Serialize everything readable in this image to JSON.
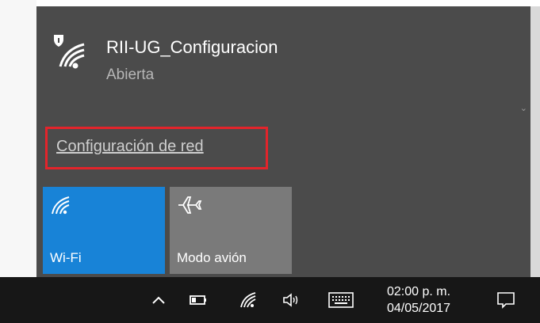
{
  "network": {
    "name": "RII-UG_Configuracion",
    "status": "Abierta",
    "icon": "wifi-secured-icon"
  },
  "settings_link": {
    "label": "Configuración de red"
  },
  "quick_actions": [
    {
      "label": "Wi-Fi",
      "icon": "wifi-icon",
      "color": "#1883d7",
      "active": true
    },
    {
      "label": "Modo avión",
      "icon": "airplane-icon",
      "color": "#7a7a7a",
      "active": false
    }
  ],
  "taskbar": {
    "time": "02:00 p. m.",
    "date": "04/05/2017",
    "icons": [
      "chevron-up-icon",
      "battery-icon",
      "wifi-icon",
      "volume-icon",
      "keyboard-icon",
      "action-center-icon"
    ]
  },
  "colors": {
    "flyout_bg": "#4b4b4b",
    "highlight_border": "#e3242b",
    "taskbar_bg": "#171717",
    "accent": "#1883d7"
  }
}
